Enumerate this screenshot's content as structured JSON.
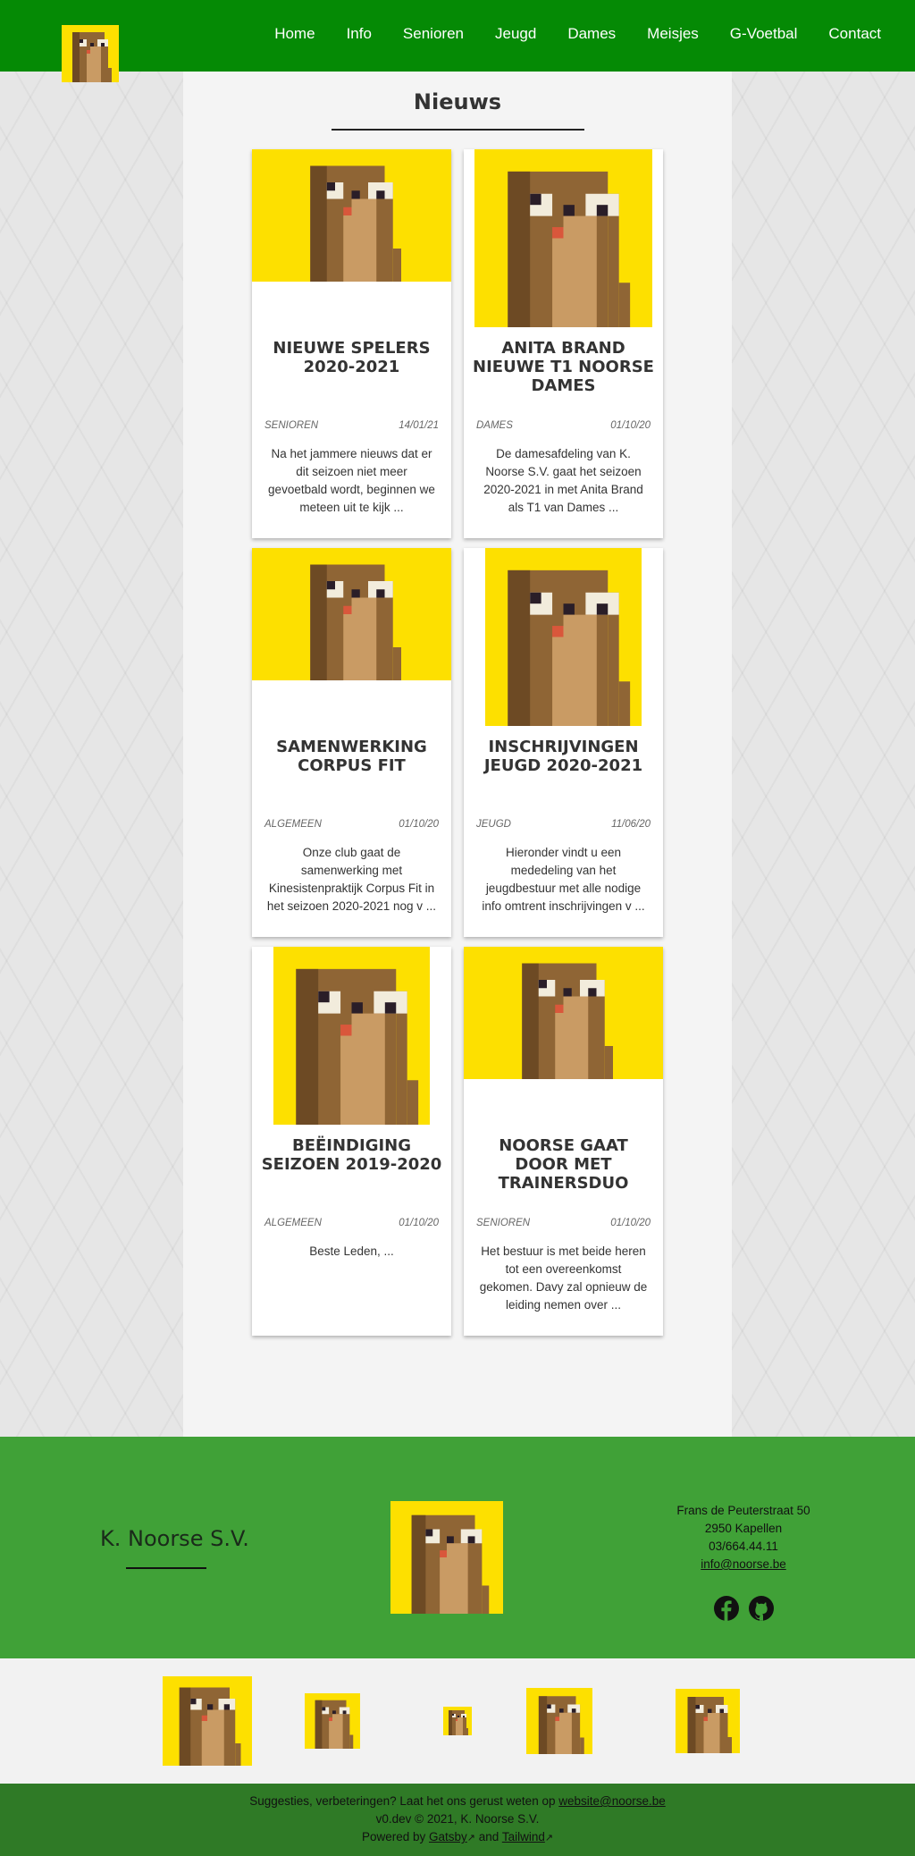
{
  "nav": {
    "items": [
      {
        "label": "Home"
      },
      {
        "label": "Info"
      },
      {
        "label": "Senioren"
      },
      {
        "label": "Jeugd"
      },
      {
        "label": "Dames"
      },
      {
        "label": "Meisjes"
      },
      {
        "label": "G-Voetbal"
      },
      {
        "label": "Contact"
      }
    ]
  },
  "main": {
    "title": "Nieuws",
    "articles": [
      {
        "title": "NIEUWE SPELERS 2020-2021",
        "category": "SENIOREN",
        "date": "14/01/21",
        "excerpt": "Na het jammere nieuws dat er dit seizoen niet meer gevoetbald wordt, beginnen we meteen uit te kijk ..."
      },
      {
        "title": "ANITA BRAND NIEUWE T1 NOORSE DAMES",
        "category": "DAMES",
        "date": "01/10/20",
        "excerpt": "De damesafdeling van K. Noorse S.V. gaat het seizoen 2020-2021 in met Anita Brand als T1 van Dames ..."
      },
      {
        "title": "SAMENWERKING CORPUS FIT",
        "category": "ALGEMEEN",
        "date": "01/10/20",
        "excerpt": "Onze club gaat de samenwerking met Kinesistenpraktijk Corpus Fit in het seizoen 2020-2021 nog v ..."
      },
      {
        "title": "INSCHRIJVINGEN JEUGD 2020-2021",
        "category": "JEUGD",
        "date": "11/06/20",
        "excerpt": "Hieronder vindt u een mededeling van het jeugdbestuur met alle nodige info omtrent inschrijvingen v ..."
      },
      {
        "title": "BEËINDIGING SEIZOEN 2019-2020",
        "category": "ALGEMEEN",
        "date": "01/10/20",
        "excerpt": "Beste Leden,   ..."
      },
      {
        "title": "NOORSE GAAT DOOR MET TRAINERSDUO",
        "category": "SENIOREN",
        "date": "01/10/20",
        "excerpt": "Het bestuur is met beide heren tot een overeenkomst gekomen. Davy zal opnieuw de leiding nemen over ..."
      }
    ]
  },
  "footer": {
    "club_name": "K. Noorse S.V.",
    "address": {
      "street": "Frans de Peuterstraat 50",
      "city": "2950 Kapellen",
      "phone": "03/664.44.11",
      "email": "info@noorse.be"
    },
    "bottom": {
      "suggestion_text": "Suggesties, verbeteringen? Laat het ons gerust weten op",
      "suggestion_email": "website@noorse.be",
      "version": "v0.dev © 2021, K. Noorse S.V.",
      "powered_by": "Powered by",
      "gatsby": "Gatsby",
      "and": "and",
      "tailwind": "Tailwind"
    }
  },
  "icons": {
    "external": "↗",
    "facebook": "facebook-icon",
    "github": "github-icon",
    "logo": "mascot-logo-icon"
  },
  "colors": {
    "header_green": "#058a05",
    "footer_green": "#40a137",
    "bottom_green": "#2f7a26",
    "mascot_yellow": "#fde000"
  }
}
